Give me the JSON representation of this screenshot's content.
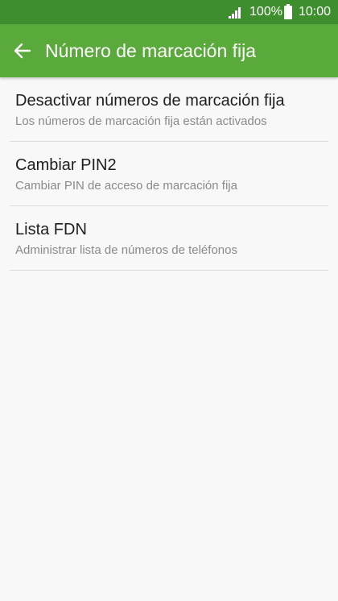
{
  "status_bar": {
    "battery_percent": "100%",
    "time": "10:00",
    "icons": [
      "signal-icon",
      "battery-icon"
    ]
  },
  "header": {
    "title": "Número de marcación fija",
    "back_icon": "arrow-left-icon",
    "color": "#5aaa3b"
  },
  "settings": {
    "items": [
      {
        "title": "Desactivar números de marcación fija",
        "subtitle": "Los números de marcación fija están activados"
      },
      {
        "title": "Cambiar PIN2",
        "subtitle": "Cambiar PIN de acceso de marcación fija"
      },
      {
        "title": "Lista FDN",
        "subtitle": "Administrar lista de números de teléfonos"
      }
    ]
  }
}
